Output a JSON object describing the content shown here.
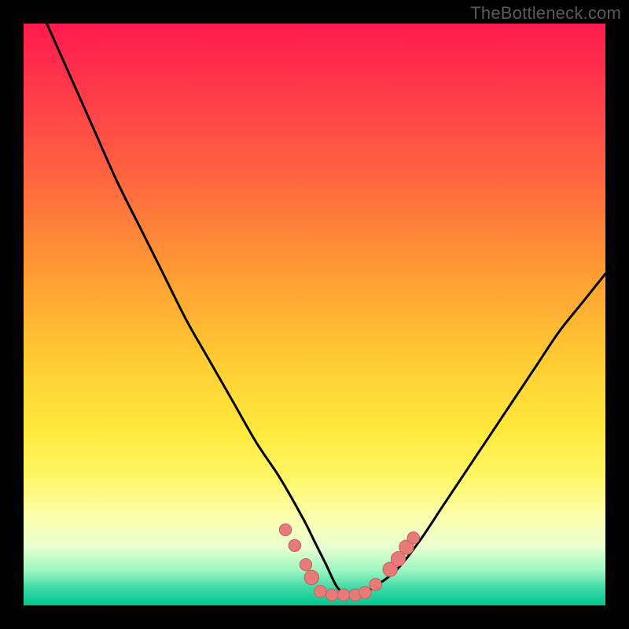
{
  "attribution": "TheBottleneck.com",
  "colors": {
    "frame": "#000000",
    "curve": "#000000",
    "marker_fill": "#e77b78",
    "marker_stroke": "#c85f5c"
  },
  "chart_data": {
    "type": "line",
    "title": "",
    "xlabel": "",
    "ylabel": "",
    "xlim": [
      0,
      100
    ],
    "ylim": [
      0,
      100
    ],
    "grid": false,
    "series": [
      {
        "name": "bottleneck-curve",
        "x": [
          4,
          8,
          12,
          16,
          20,
          24,
          28,
          32,
          36,
          40,
          44,
          48,
          50,
          52,
          54,
          56,
          58,
          60,
          64,
          68,
          72,
          76,
          80,
          84,
          88,
          92,
          96,
          100
        ],
        "y": [
          100,
          91,
          82,
          73,
          65,
          57,
          49,
          42,
          35,
          28,
          22,
          15,
          11,
          7,
          3,
          2,
          2,
          3,
          6,
          11,
          17,
          23,
          29,
          35,
          41,
          47,
          52,
          57
        ]
      }
    ],
    "markers": [
      {
        "x": 45.0,
        "y": 13.0,
        "r": 1.0
      },
      {
        "x": 46.6,
        "y": 10.3,
        "r": 1.0
      },
      {
        "x": 48.5,
        "y": 7.0,
        "r": 1.0
      },
      {
        "x": 49.5,
        "y": 4.8,
        "r": 1.4
      },
      {
        "x": 51.0,
        "y": 2.4,
        "r": 1.0
      },
      {
        "x": 53.0,
        "y": 1.8,
        "r": 1.0
      },
      {
        "x": 55.0,
        "y": 1.8,
        "r": 1.0
      },
      {
        "x": 57.0,
        "y": 1.8,
        "r": 1.0
      },
      {
        "x": 58.7,
        "y": 2.2,
        "r": 1.0
      },
      {
        "x": 60.5,
        "y": 3.6,
        "r": 1.0
      },
      {
        "x": 63.0,
        "y": 6.2,
        "r": 1.4
      },
      {
        "x": 64.4,
        "y": 8.0,
        "r": 1.4
      },
      {
        "x": 65.8,
        "y": 10.0,
        "r": 1.4
      },
      {
        "x": 67.0,
        "y": 11.6,
        "r": 1.0
      }
    ]
  }
}
